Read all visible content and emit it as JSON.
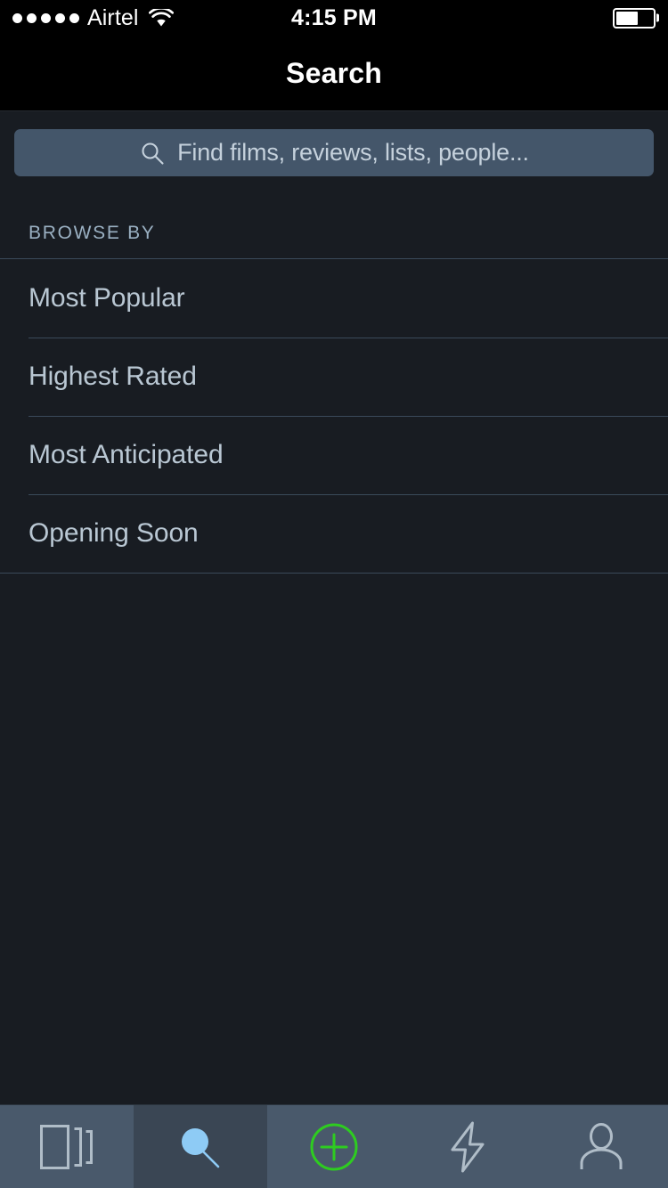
{
  "status_bar": {
    "signal_dots": 5,
    "signal_dots_filled": 5,
    "carrier": "Airtel",
    "wifi_icon": "wifi-icon",
    "time": "4:15 PM",
    "battery_icon": "battery-icon",
    "battery_level_percent": 60
  },
  "nav_bar": {
    "title": "Search"
  },
  "search": {
    "icon": "search-icon",
    "placeholder": "Find films, reviews, lists, people...",
    "value": ""
  },
  "browse": {
    "section_label": "BROWSE BY",
    "items": [
      {
        "label": "Most Popular"
      },
      {
        "label": "Highest Rated"
      },
      {
        "label": "Most Anticipated"
      },
      {
        "label": "Opening Soon"
      }
    ]
  },
  "tab_bar": {
    "active_index": 1,
    "items": [
      {
        "icon": "films-stack-icon",
        "label": "Films",
        "active": false
      },
      {
        "icon": "search-magnifier-icon",
        "label": "Search",
        "active": true
      },
      {
        "icon": "plus-circle-icon",
        "label": "Add",
        "active": false
      },
      {
        "icon": "lightning-bolt-icon",
        "label": "Activity",
        "active": false
      },
      {
        "icon": "person-icon",
        "label": "Profile",
        "active": false
      }
    ]
  },
  "colors": {
    "background": "#181c22",
    "nav_bar": "#000000",
    "search_field": "#44566a",
    "tab_bar": "#49596b",
    "tab_active": "#3a4654",
    "separator": "#3a4a5a",
    "primary_text": "#b9c7d3",
    "accent_blue": "#8ecbf5",
    "accent_green": "#2ecc20",
    "icon_gray": "#b0bdc8"
  }
}
